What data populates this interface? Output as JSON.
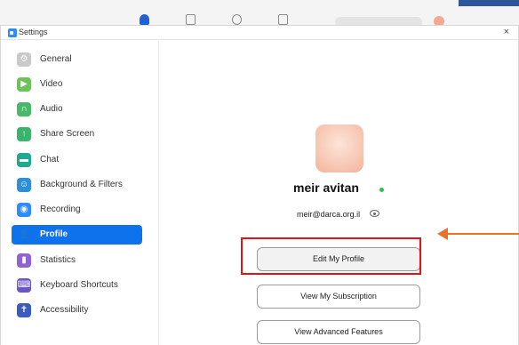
{
  "window": {
    "title": "Settings",
    "close_glyph": "×"
  },
  "sidebar": {
    "items": [
      {
        "label": "General",
        "icon": "gear-icon",
        "color": "#c9c9c9",
        "glyph": "⚙",
        "active": false
      },
      {
        "label": "Video",
        "icon": "video-camera-icon",
        "color": "#6cc35a",
        "glyph": "▶",
        "active": false
      },
      {
        "label": "Audio",
        "icon": "headphones-icon",
        "color": "#49b86b",
        "glyph": "∩",
        "active": false
      },
      {
        "label": "Share Screen",
        "icon": "share-screen-icon",
        "color": "#38b56b",
        "glyph": "↑",
        "active": false
      },
      {
        "label": "Chat",
        "icon": "chat-icon",
        "color": "#20a990",
        "glyph": "▬",
        "active": false
      },
      {
        "label": "Background & Filters",
        "icon": "background-filters-icon",
        "color": "#2e8fd6",
        "glyph": "☺",
        "active": false
      },
      {
        "label": "Recording",
        "icon": "recording-icon",
        "color": "#2d8cff",
        "glyph": "◉",
        "active": false
      },
      {
        "label": "Profile",
        "icon": "profile-icon",
        "color": "#0e72ed",
        "glyph": "👤",
        "active": true
      },
      {
        "label": "Statistics",
        "icon": "statistics-icon",
        "color": "#8f63d8",
        "glyph": "▮",
        "active": false
      },
      {
        "label": "Keyboard Shortcuts",
        "icon": "keyboard-icon",
        "color": "#6a55c9",
        "glyph": "⌨",
        "active": false
      },
      {
        "label": "Accessibility",
        "icon": "accessibility-icon",
        "color": "#3a5bbf",
        "glyph": "✝",
        "active": false
      }
    ]
  },
  "profile": {
    "name": "meir avitan",
    "email": "meir@darca.org.il",
    "status_color": "#23c552",
    "buttons": {
      "edit": "Edit My Profile",
      "subscription": "View My Subscription",
      "advanced": "View Advanced Features"
    }
  },
  "colors": {
    "accent": "#0e72ed",
    "highlight_box": "#e31313",
    "arrow": "#e8742a"
  }
}
